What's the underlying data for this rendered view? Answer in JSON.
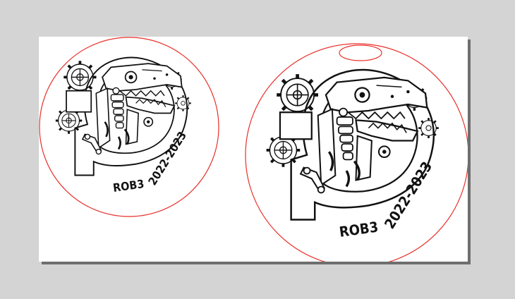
{
  "document": {
    "colors": {
      "cut_line": "#e8302a",
      "engrave": "#111111",
      "background": "#d4d4d4",
      "canvas": "#ffffff"
    },
    "medallions": [
      {
        "id": "small",
        "label": "ROB3",
        "years": "2022-2023",
        "has_hanging_slot": false
      },
      {
        "id": "large",
        "label": "ROB3",
        "years": "2022-2023",
        "has_hanging_slot": true
      }
    ]
  }
}
